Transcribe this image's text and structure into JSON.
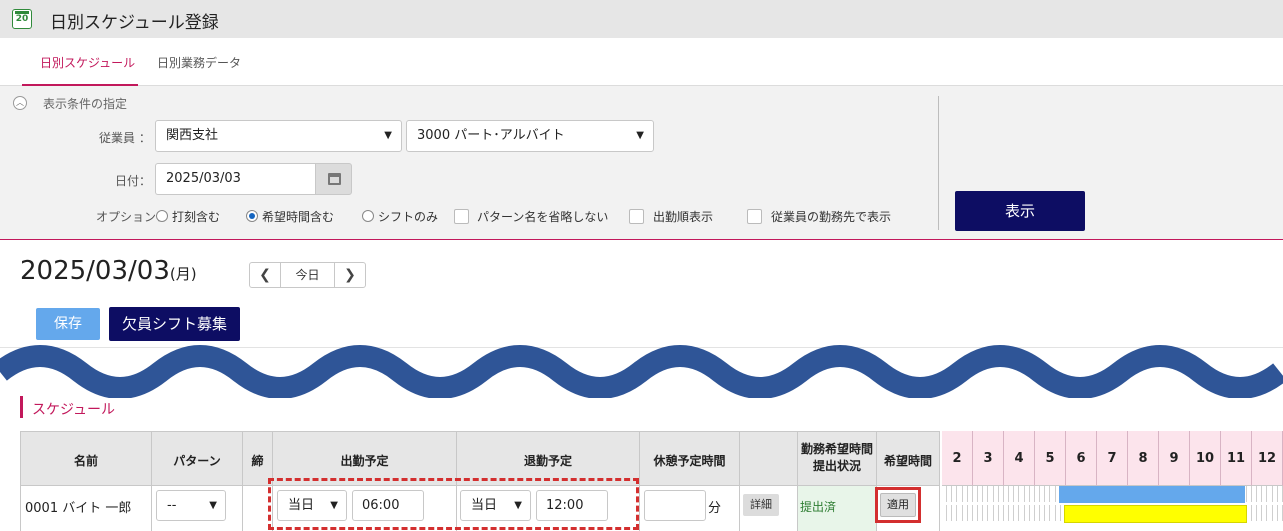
{
  "window": {
    "title": "日別スケジュール登録",
    "icon_text": "20"
  },
  "tabs": [
    {
      "label": "日別スケジュール",
      "active": true
    },
    {
      "label": "日別業務データ",
      "active": false
    }
  ],
  "conditions": {
    "title": "表示条件の指定",
    "employee_label": "従業員 ：",
    "employee_org": "関西支社",
    "employee_type": "3000 パート･アルバイト",
    "date_label": "日付：",
    "date_value": "2025/03/03",
    "option_label": "オプション：",
    "options": [
      {
        "label": "打刻含む",
        "type": "radio",
        "checked": false
      },
      {
        "label": "希望時間含む",
        "type": "radio",
        "checked": true
      },
      {
        "label": "シフトのみ",
        "type": "radio",
        "checked": false
      },
      {
        "label": "パターン名を省略しない",
        "type": "checkbox",
        "checked": false
      },
      {
        "label": "出勤順表示",
        "type": "checkbox",
        "checked": false
      },
      {
        "label": "従業員の勤務先で表示",
        "type": "checkbox",
        "checked": false
      }
    ],
    "show_button": "表示"
  },
  "day": {
    "date": "2025/03/03",
    "weekday": "(月)",
    "today_button": "今日"
  },
  "actions": {
    "save": "保存",
    "recruit": "欠員シフト募集"
  },
  "schedule": {
    "title": "スケジュール",
    "columns": {
      "name": "名前",
      "pattern": "パターン",
      "close": "締",
      "start": "出勤予定",
      "end": "退勤予定",
      "break": "休憩予定時間",
      "request_status_line1": "勤務希望時間",
      "request_status_line2": "提出状況",
      "request_time": "希望時間"
    },
    "hours": [
      "2",
      "3",
      "4",
      "5",
      "6",
      "7",
      "8",
      "9",
      "10",
      "11",
      "12"
    ],
    "rows": [
      {
        "name": "0001 バイト 一郎",
        "pattern": "--",
        "start_day": "当日",
        "start_time": "06:00",
        "end_day": "当日",
        "end_time": "12:00",
        "break_value": "",
        "break_unit": "分",
        "detail": "詳細",
        "status": "提出済",
        "apply": "適用"
      }
    ]
  },
  "colors": {
    "accent": "#c2185b",
    "navy": "#0d0d63",
    "save_blue": "#64a8ec",
    "wave": "#2f5597",
    "timeline_blue": "#64a8ec",
    "timeline_yellow": "#ffff00",
    "highlight_red": "#d32f2f"
  }
}
